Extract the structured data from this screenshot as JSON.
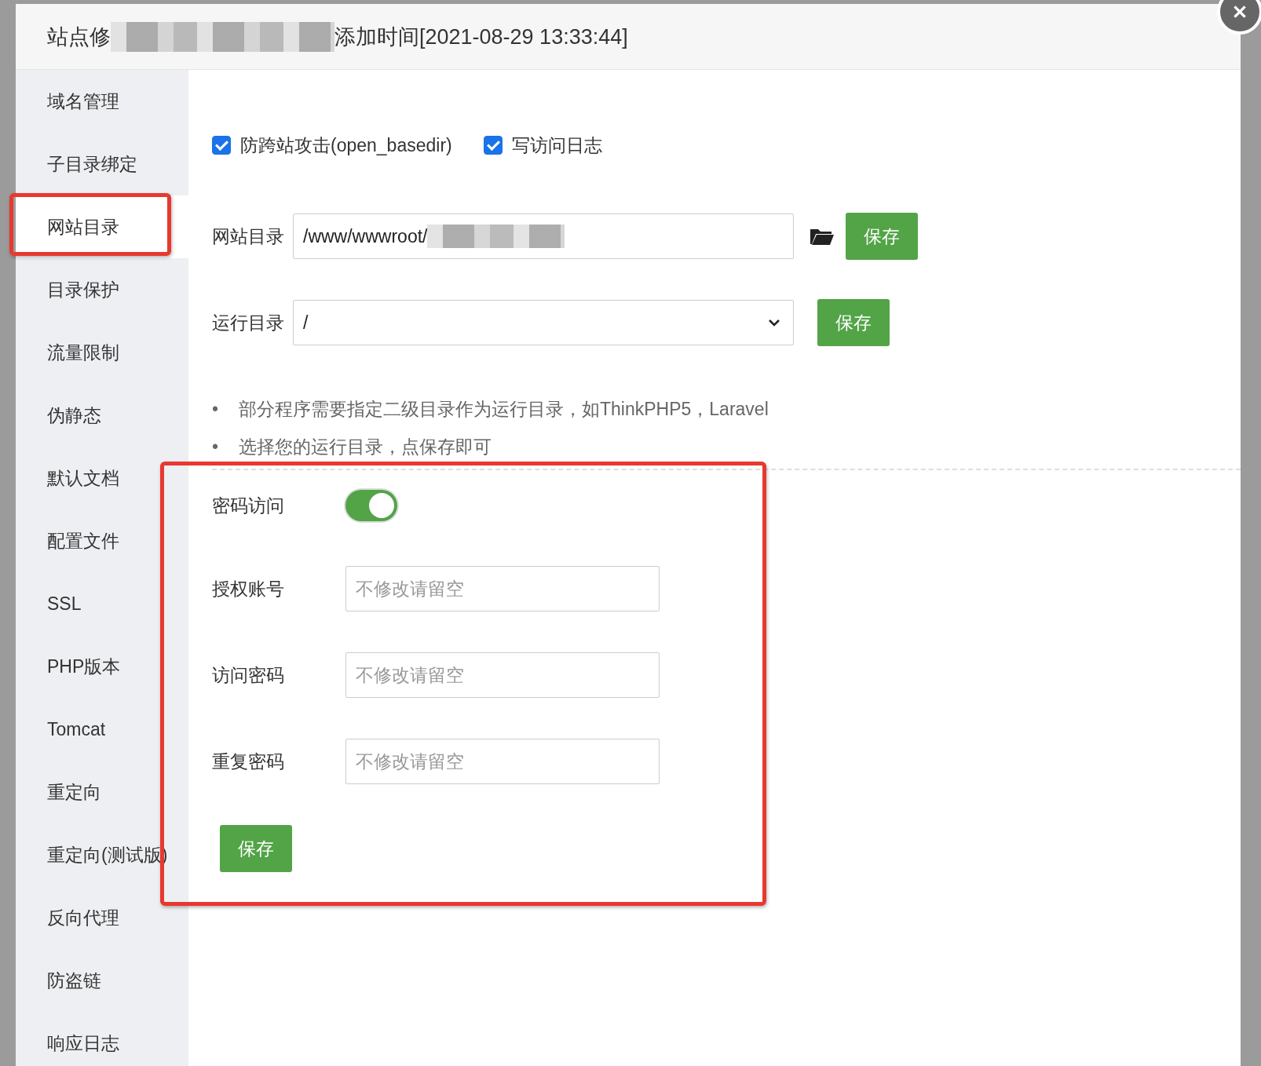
{
  "dialog": {
    "title_start": "站点修",
    "title_end": "添加时间[2021-08-29 13:33:44]"
  },
  "sidebar": {
    "items": [
      {
        "label": "域名管理",
        "selected": false
      },
      {
        "label": "子目录绑定",
        "selected": false
      },
      {
        "label": "网站目录",
        "selected": true
      },
      {
        "label": "目录保护",
        "selected": false
      },
      {
        "label": "流量限制",
        "selected": false
      },
      {
        "label": "伪静态",
        "selected": false
      },
      {
        "label": "默认文档",
        "selected": false
      },
      {
        "label": "配置文件",
        "selected": false
      },
      {
        "label": "SSL",
        "selected": false
      },
      {
        "label": "PHP版本",
        "selected": false
      },
      {
        "label": "Tomcat",
        "selected": false
      },
      {
        "label": "重定向",
        "selected": false
      },
      {
        "label": "重定向(测试版)",
        "selected": false
      },
      {
        "label": "反向代理",
        "selected": false
      },
      {
        "label": "防盗链",
        "selected": false
      },
      {
        "label": "响应日志",
        "selected": false
      }
    ]
  },
  "options": [
    {
      "label": "防跨站攻击(open_basedir)",
      "checked": true
    },
    {
      "label": "写访问日志",
      "checked": true
    }
  ],
  "site_dir": {
    "label": "网站目录",
    "value": "/www/wwwroot/",
    "button": "保存"
  },
  "run_dir": {
    "label": "运行目录",
    "value": "/",
    "button": "保存"
  },
  "notes": [
    {
      "marker": "•",
      "text": "部分程序需要指定二级目录作为运行目录，如ThinkPHP5，Laravel"
    },
    {
      "marker": "•",
      "text": "选择您的运行目录，点保存即可"
    }
  ],
  "password_access": {
    "label": "密码访问",
    "on": true,
    "fields": [
      {
        "label": "授权账号",
        "placeholder": "不修改请留空"
      },
      {
        "label": "访问密码",
        "placeholder": "不修改请留空"
      },
      {
        "label": "重复密码",
        "placeholder": "不修改请留空"
      }
    ],
    "button": "保存"
  }
}
